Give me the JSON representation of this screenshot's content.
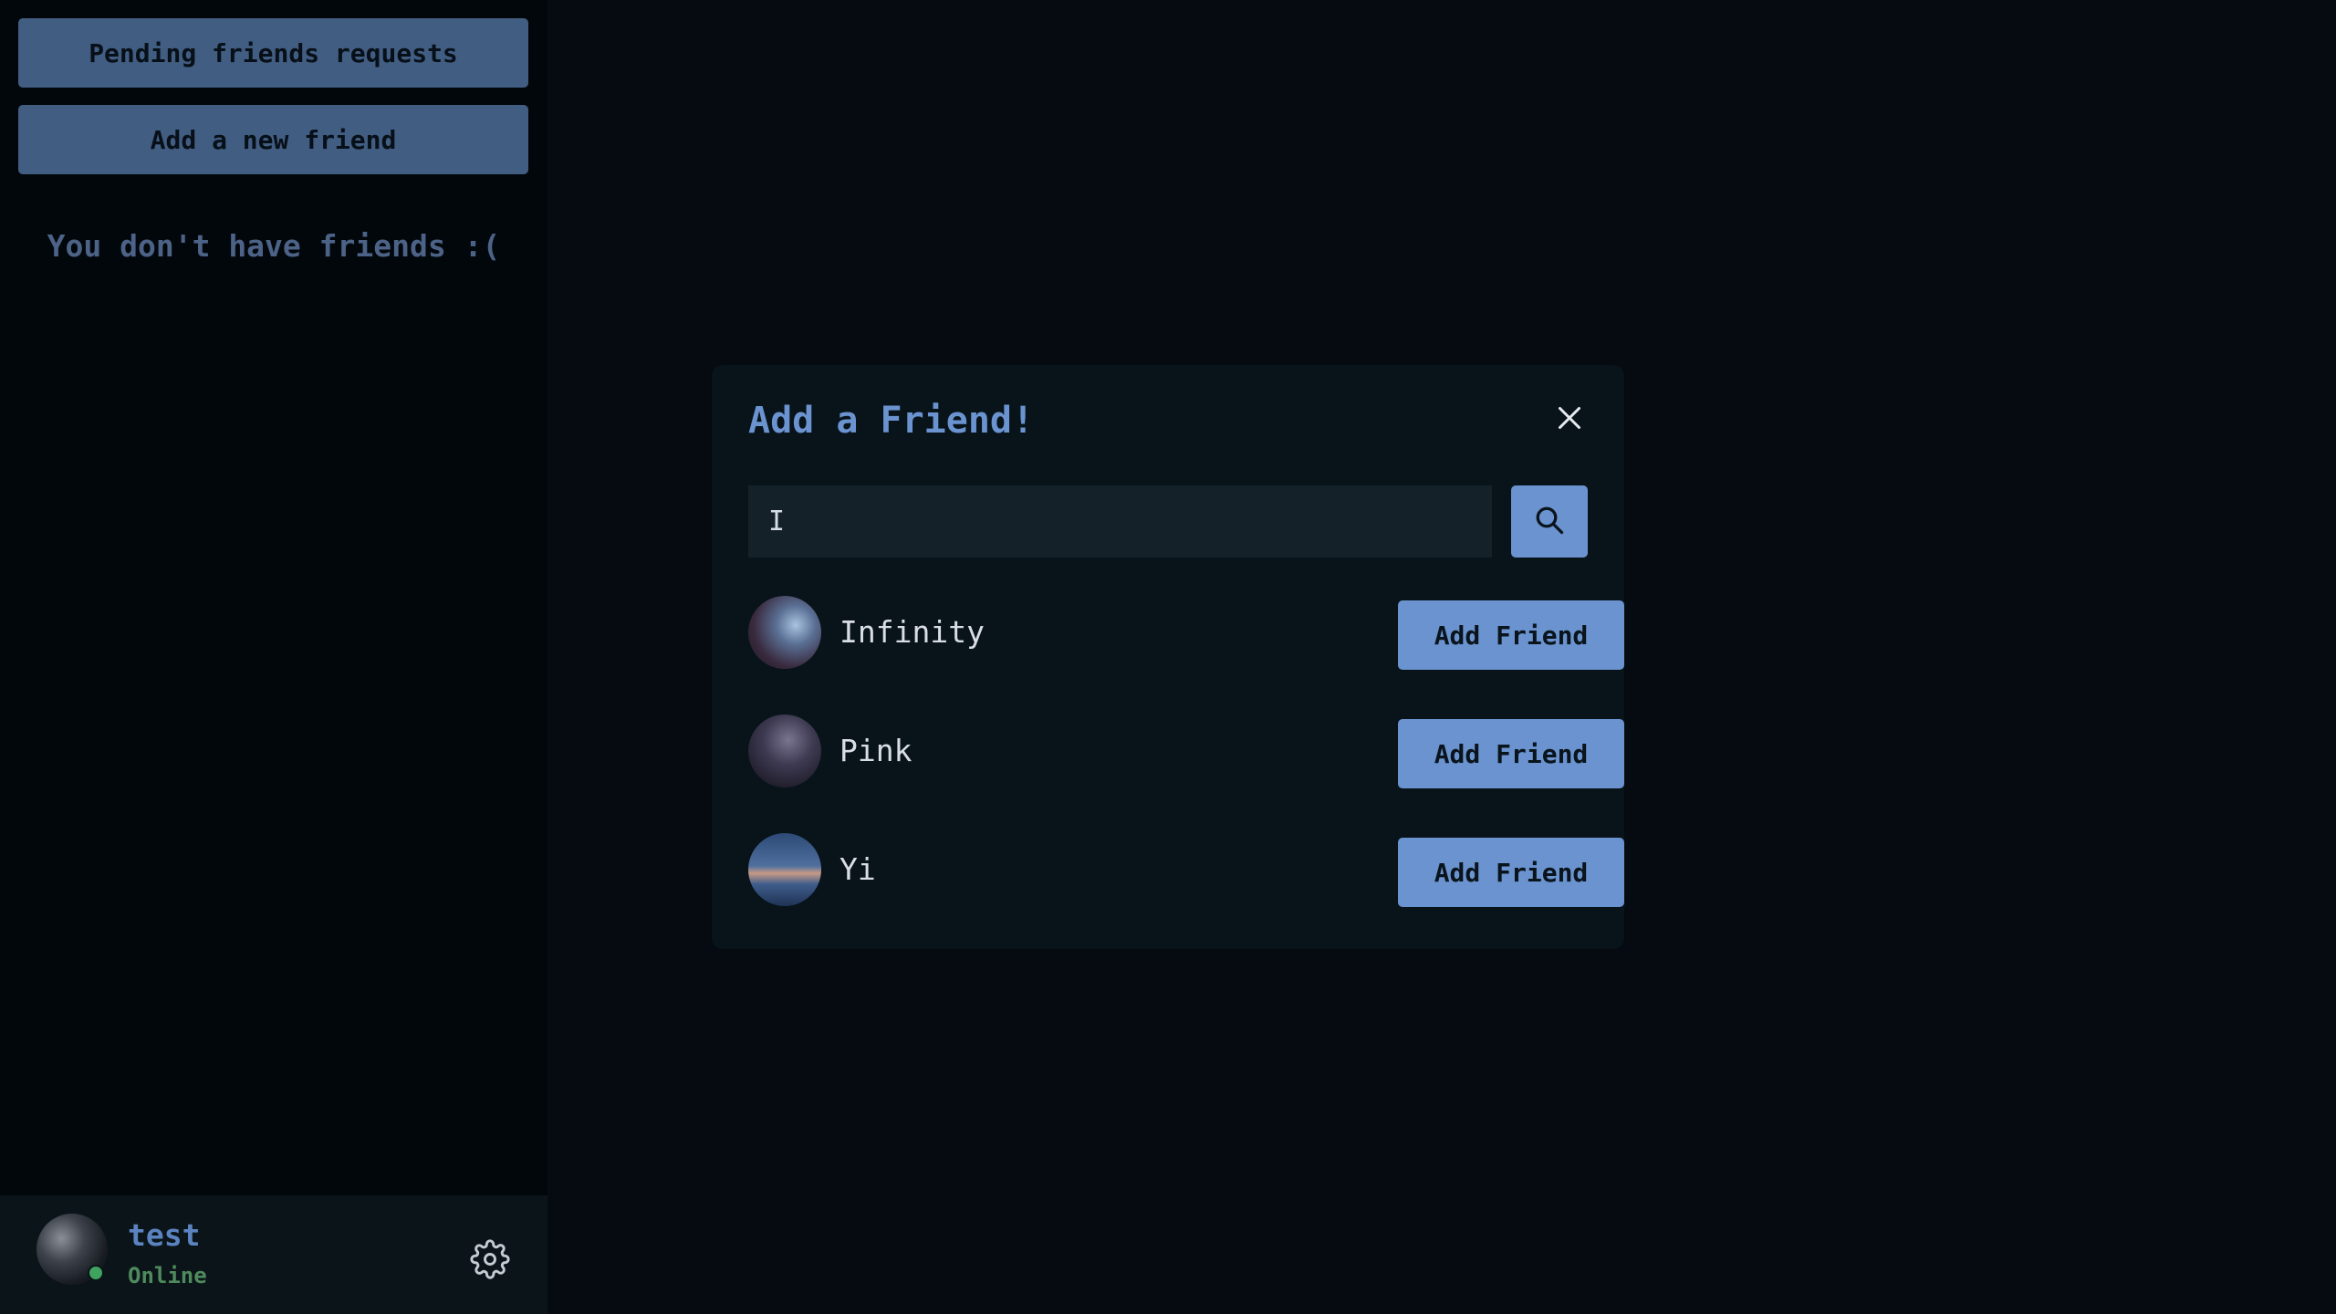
{
  "sidebar": {
    "pending_label": "Pending friends requests",
    "add_new_label": "Add a new friend",
    "empty_message": "You don't have friends :("
  },
  "user": {
    "name": "test",
    "status": "Online",
    "avatar_icon": "user-avatar",
    "settings_icon": "gear-icon"
  },
  "modal": {
    "title": "Add a Friend!",
    "close_icon": "close-icon",
    "search": {
      "value": "I",
      "placeholder": "",
      "button_icon": "search-icon"
    },
    "results": [
      {
        "name": "Infinity",
        "button_label": "Add Friend"
      },
      {
        "name": "Pink",
        "button_label": "Add Friend"
      },
      {
        "name": "Yi",
        "button_label": "Add Friend"
      }
    ]
  },
  "colors": {
    "background": "#050b10",
    "sidebar": "#02070b",
    "accent": "#6a93cf",
    "sidebar_button": "#425d82",
    "online": "#3fa35f"
  }
}
